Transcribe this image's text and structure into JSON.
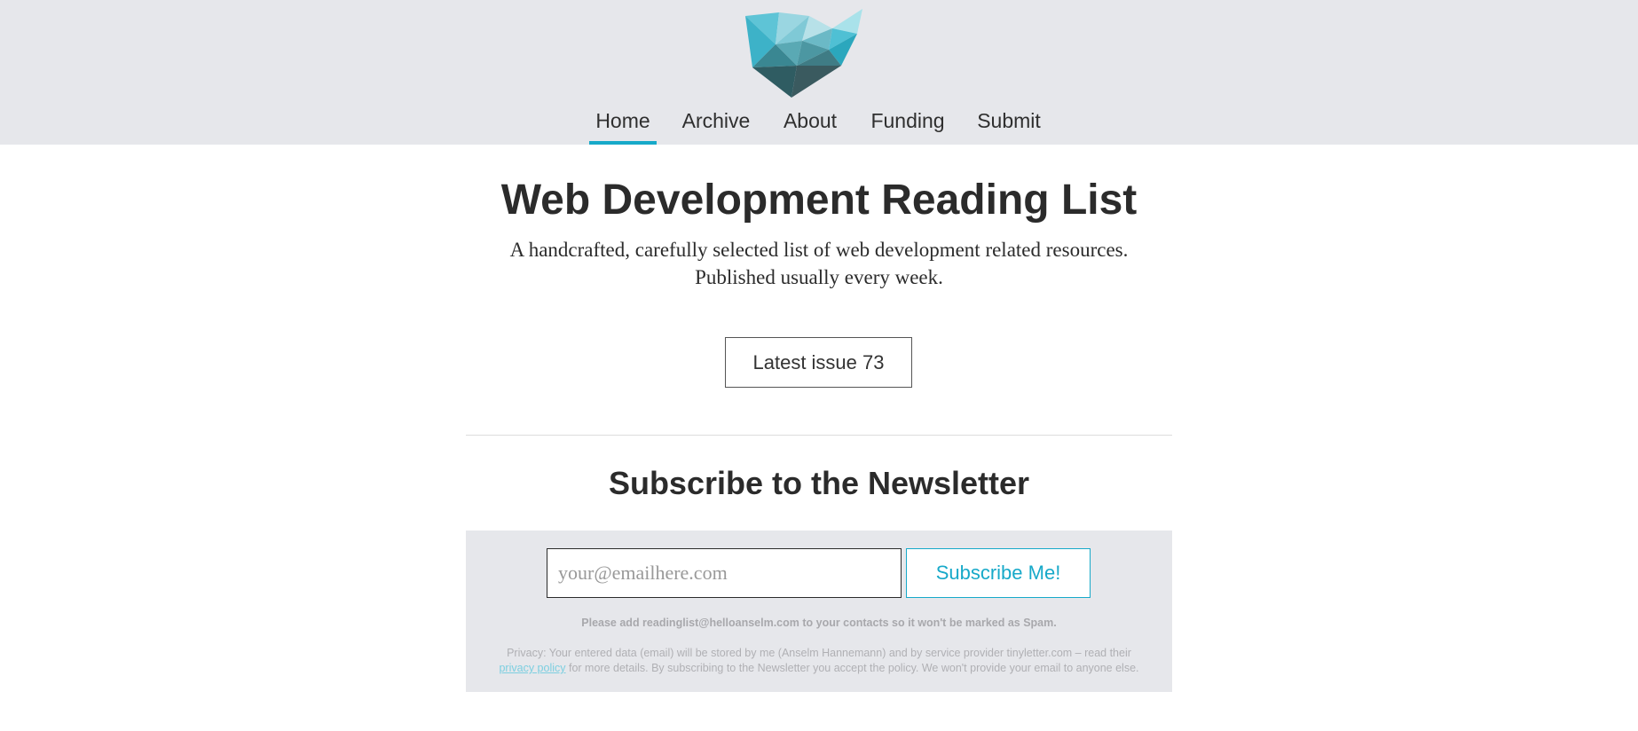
{
  "colors": {
    "accent": "#17a9c9",
    "header_bg": "#e6e7eb",
    "text": "#2b2b2b"
  },
  "header": {
    "logo_icon": "polygon-crystal-logo",
    "nav": [
      {
        "label": "Home",
        "active": true
      },
      {
        "label": "Archive",
        "active": false
      },
      {
        "label": "About",
        "active": false
      },
      {
        "label": "Funding",
        "active": false
      },
      {
        "label": "Submit",
        "active": false
      }
    ]
  },
  "hero": {
    "title": "Web Development Reading List",
    "subtitle_line1": "A handcrafted, carefully selected list of web development related resources.",
    "subtitle_line2": "Published usually every week.",
    "latest_issue_label": "Latest issue 73"
  },
  "newsletter": {
    "title": "Subscribe to the Newsletter",
    "email_placeholder": "your@emailhere.com",
    "subscribe_label": "Subscribe Me!",
    "note": "Please add readinglist@helloanselm.com to your contacts so it won't be marked as Spam.",
    "privacy_before": "Privacy: Your entered data (email) will be stored by me (Anselm Hannemann) and by service provider tinyletter.com – read their",
    "privacy_link": "privacy policy",
    "privacy_after": " for more details. By subscribing to the Newsletter you accept the policy. We won't provide your email to anyone else."
  }
}
